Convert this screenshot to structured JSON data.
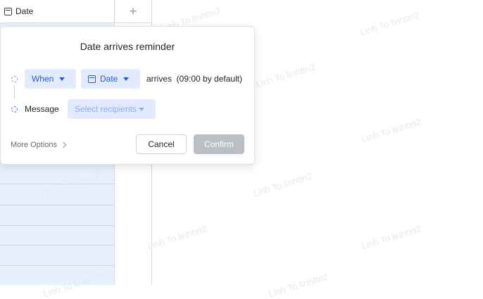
{
  "grid": {
    "column_label": "Date",
    "add_column_symbol": "+"
  },
  "watermark_text": "Linh To linhttn2",
  "popover": {
    "title": "Date arrives reminder",
    "when_label": "When",
    "field_label": "Date",
    "arrives_text": "arrives  (09:00 by default)",
    "message_label": "Message",
    "recipients_placeholder": "Select recipients",
    "more_options": "More Options",
    "cancel": "Cancel",
    "confirm": "Confirm"
  },
  "colors": {
    "accent": "#245bdb",
    "chip_bg": "#e1eaff",
    "confirm_disabled": "#bbbfc4",
    "grid_selected": "#e9f0fd"
  }
}
